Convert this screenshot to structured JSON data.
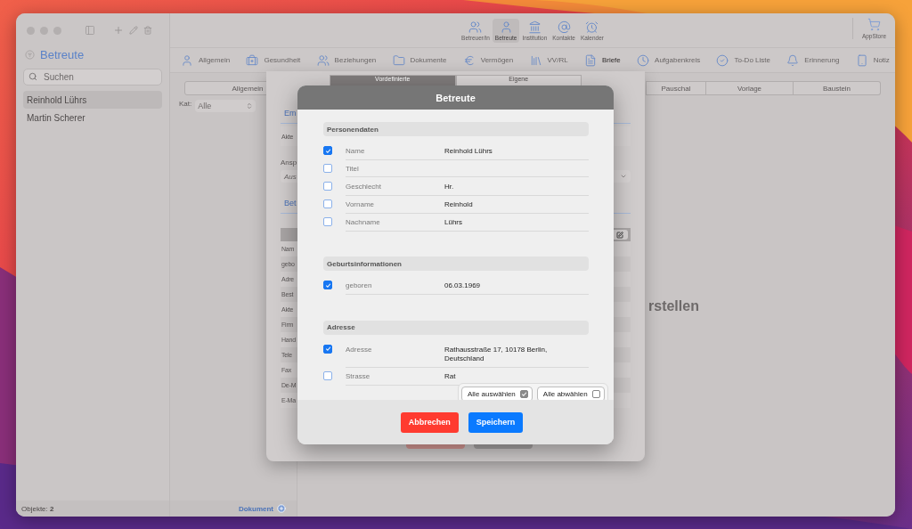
{
  "sidebar": {
    "title": "Betreute",
    "search": {
      "placeholder": "Suchen"
    },
    "items": [
      {
        "label": "Reinhold Lührs",
        "selected": true
      },
      {
        "label": "Martin Scherer",
        "selected": false
      }
    ],
    "footer": "Objekte: **2**"
  },
  "toolbar": {
    "items": [
      {
        "label": "Betreuer/in",
        "selected": false
      },
      {
        "label": "Betreute",
        "selected": true
      },
      {
        "label": "Institution",
        "selected": false
      },
      {
        "label": "Kontakte",
        "selected": false
      },
      {
        "label": "Kalender",
        "selected": false
      }
    ],
    "store": "AppStore"
  },
  "sections": [
    {
      "label": "Allgemein",
      "selected": false
    },
    {
      "label": "Gesundheit",
      "selected": false
    },
    {
      "label": "Beziehungen",
      "selected": false
    },
    {
      "label": "Dokumente",
      "selected": false
    },
    {
      "label": "Vermögen",
      "selected": false
    },
    {
      "label": "VV/RL",
      "selected": false
    },
    {
      "label": "Briefe",
      "selected": true
    },
    {
      "label": "Aufgabenkreis",
      "selected": false
    },
    {
      "label": "To-Do Liste",
      "selected": false
    },
    {
      "label": "Erinnerung",
      "selected": false
    },
    {
      "label": "Notiz",
      "selected": false
    }
  ],
  "middle": {
    "segment": "Allgemein",
    "kat_label": "Kat:",
    "kat_value": "Alle",
    "footer": "Dokument"
  },
  "main": {
    "segments": [
      "Pauschal",
      "Vorlage",
      "Baustein"
    ],
    "message": "rstellen"
  },
  "back_sheet": {
    "tabs": [
      {
        "label": "Vordefinierte",
        "selected": true
      },
      {
        "label": "Eigene",
        "selected": false
      }
    ],
    "heading_1": "Em",
    "field_1": "Akte",
    "label_2": "Ansp",
    "placeholder_2": "Aus",
    "heading_2": "Bet",
    "rows": [
      "Nam",
      "gebo",
      "Adre",
      "Best",
      "Akte",
      "Firm",
      "Hand",
      "Tele",
      "Fax",
      "De-M",
      "E-Ma"
    ]
  },
  "dialog": {
    "title": "Betreute",
    "sections": [
      {
        "title": "Personendaten",
        "rows": [
          {
            "label": "Name",
            "value": "Reinhold Lührs",
            "checked": true
          },
          {
            "label": "Titel",
            "checked": false
          },
          {
            "label": "Geschlecht",
            "value": "Hr.",
            "checked": false
          },
          {
            "label": "Vorname",
            "value": "Reinhold",
            "checked": false
          },
          {
            "label": "Nachname",
            "value": "Lührs",
            "checked": false
          }
        ]
      },
      {
        "title": "Geburtsinformationen",
        "rows": [
          {
            "label": "geboren",
            "value": "06.03.1969",
            "checked": true
          }
        ]
      },
      {
        "title": "Adresse",
        "rows": [
          {
            "label": "Adresse",
            "value": "Rathausstraße 17, 10178 Berlin, Deutschland",
            "checked": true
          },
          {
            "label": "Strasse",
            "value": "Rat",
            "checked": false
          }
        ]
      }
    ],
    "popup": [
      {
        "label": "Alle auswählen",
        "checked": true
      },
      {
        "label": "Alle abwählen",
        "checked": false
      }
    ],
    "buttons": [
      {
        "label": "Abbrechen",
        "kind": "cancel"
      },
      {
        "label": "Speichern",
        "kind": "save"
      }
    ]
  }
}
